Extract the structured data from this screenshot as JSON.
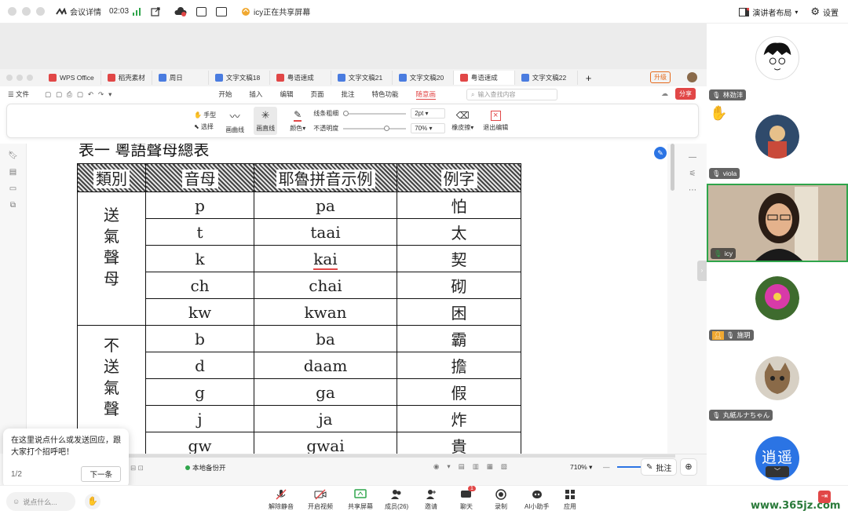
{
  "topbar": {
    "meeting_details": "会议详情",
    "time": "02:03",
    "sharing_status": "icy正在共享屏幕",
    "layout_label": "演讲者布局",
    "settings_label": "设置"
  },
  "wps": {
    "tabs": [
      "WPS Office",
      "稻壳素材",
      "周日",
      "文字文稿18",
      "粤语速成",
      "文字文稿21",
      "文字文稿20",
      "粤语速成",
      "文字文稿22"
    ],
    "upgrade": "升级",
    "file_menu": "文件",
    "menu": [
      "开始",
      "插入",
      "编辑",
      "页面",
      "批注",
      "特色功能",
      "随意画"
    ],
    "search_placeholder": "输入查找内容",
    "share": "分享",
    "ribbon": {
      "hand": "手型",
      "select": "选择",
      "curve": "画曲线",
      "line": "画直线",
      "color": "颜色",
      "thickness": "线条粗细",
      "opacity": "不透明度",
      "thickness_val": "2pt",
      "opacity_val": "70%",
      "eraser": "橡皮擦",
      "exit": "退出编辑"
    },
    "status": {
      "backup": "本地备份开",
      "zoom": "710%",
      "annotate": "批注"
    }
  },
  "document": {
    "heading": "表一 粵語聲母總表",
    "headers": [
      "類別",
      "音母",
      "耶魯拼音示例",
      "例字"
    ],
    "group1": [
      "送",
      "氣",
      "聲",
      "母"
    ],
    "group2": [
      "不",
      "送",
      "氣",
      "聲"
    ],
    "rows": [
      [
        "p",
        "pa",
        "怕"
      ],
      [
        "t",
        "taai",
        "太"
      ],
      [
        "k",
        "kai",
        "契"
      ],
      [
        "ch",
        "chai",
        "砌"
      ],
      [
        "kw",
        "kwan",
        "困"
      ],
      [
        "b",
        "ba",
        "霸"
      ],
      [
        "d",
        "daam",
        "擔"
      ],
      [
        "g",
        "ga",
        "假"
      ],
      [
        "j",
        "ja",
        "炸"
      ],
      [
        "gw",
        "gwai",
        "貴"
      ]
    ]
  },
  "participants": [
    {
      "name": "林劲沣"
    },
    {
      "name": "viola"
    },
    {
      "name": "icy"
    },
    {
      "name": "施玥"
    },
    {
      "name": "丸紙ルナちゃん"
    },
    {
      "name": "逍遥",
      "avatar_text": "逍遥"
    }
  ],
  "popup": {
    "message": "在这里说点什么或发送回应，跟大家打个招呼吧！",
    "page": "1/2",
    "next": "下一条"
  },
  "chat_input": {
    "placeholder": "说点什么..."
  },
  "bottombar": {
    "unmute": "解除静音",
    "video": "开启视频",
    "share": "共享屏幕",
    "members": "成员(26)",
    "invite": "邀请",
    "chat": "聊天",
    "chat_badge": "1",
    "record": "录制",
    "ai": "AI小助手",
    "apps": "应用"
  },
  "watermark": "www.365jz.com",
  "colors": {
    "accent": "#2b74e4",
    "danger": "#e14747",
    "green": "#2fa54b"
  }
}
